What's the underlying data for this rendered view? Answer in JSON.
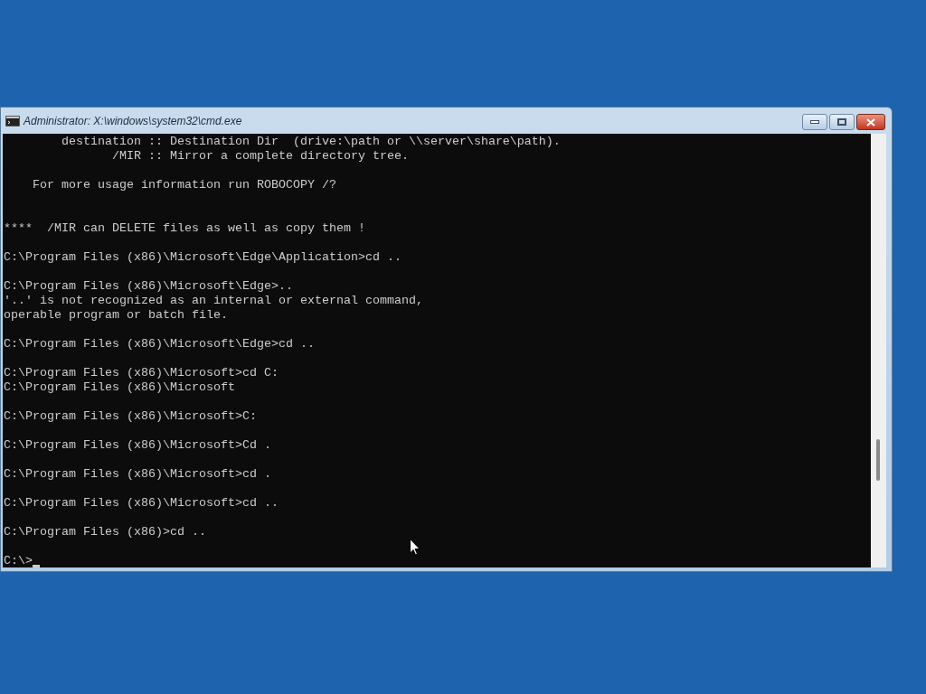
{
  "window": {
    "title": "Administrator: X:\\windows\\system32\\cmd.exe"
  },
  "console": {
    "lines": [
      {
        "kind": "text",
        "text": "        destination :: Destination Dir  (drive:\\path or \\\\server\\share\\path)."
      },
      {
        "kind": "text",
        "text": "               /MIR :: Mirror a complete directory tree."
      },
      {
        "kind": "blank"
      },
      {
        "kind": "text",
        "text": "    For more usage information run ROBOCOPY /?"
      },
      {
        "kind": "blank"
      },
      {
        "kind": "blank"
      },
      {
        "kind": "text",
        "text": "****  /MIR can DELETE files as well as copy them !"
      },
      {
        "kind": "blank"
      },
      {
        "kind": "text",
        "text": "C:\\Program Files (x86)\\Microsoft\\Edge\\Application>cd .."
      },
      {
        "kind": "blank"
      },
      {
        "kind": "text",
        "text": "C:\\Program Files (x86)\\Microsoft\\Edge>.."
      },
      {
        "kind": "text",
        "text": "'..' is not recognized as an internal or external command,"
      },
      {
        "kind": "text",
        "text": "operable program or batch file."
      },
      {
        "kind": "blank"
      },
      {
        "kind": "text",
        "text": "C:\\Program Files (x86)\\Microsoft\\Edge>cd .."
      },
      {
        "kind": "blank"
      },
      {
        "kind": "text",
        "text": "C:\\Program Files (x86)\\Microsoft>cd C:"
      },
      {
        "kind": "text",
        "text": "C:\\Program Files (x86)\\Microsoft"
      },
      {
        "kind": "blank"
      },
      {
        "kind": "text",
        "text": "C:\\Program Files (x86)\\Microsoft>C:"
      },
      {
        "kind": "blank"
      },
      {
        "kind": "text",
        "text": "C:\\Program Files (x86)\\Microsoft>Cd ."
      },
      {
        "kind": "blank"
      },
      {
        "kind": "text",
        "text": "C:\\Program Files (x86)\\Microsoft>cd ."
      },
      {
        "kind": "blank"
      },
      {
        "kind": "text",
        "text": "C:\\Program Files (x86)\\Microsoft>cd .."
      },
      {
        "kind": "blank"
      },
      {
        "kind": "text",
        "text": "C:\\Program Files (x86)>cd .."
      },
      {
        "kind": "blank"
      },
      {
        "kind": "prompt",
        "text": "C:\\>"
      }
    ]
  }
}
